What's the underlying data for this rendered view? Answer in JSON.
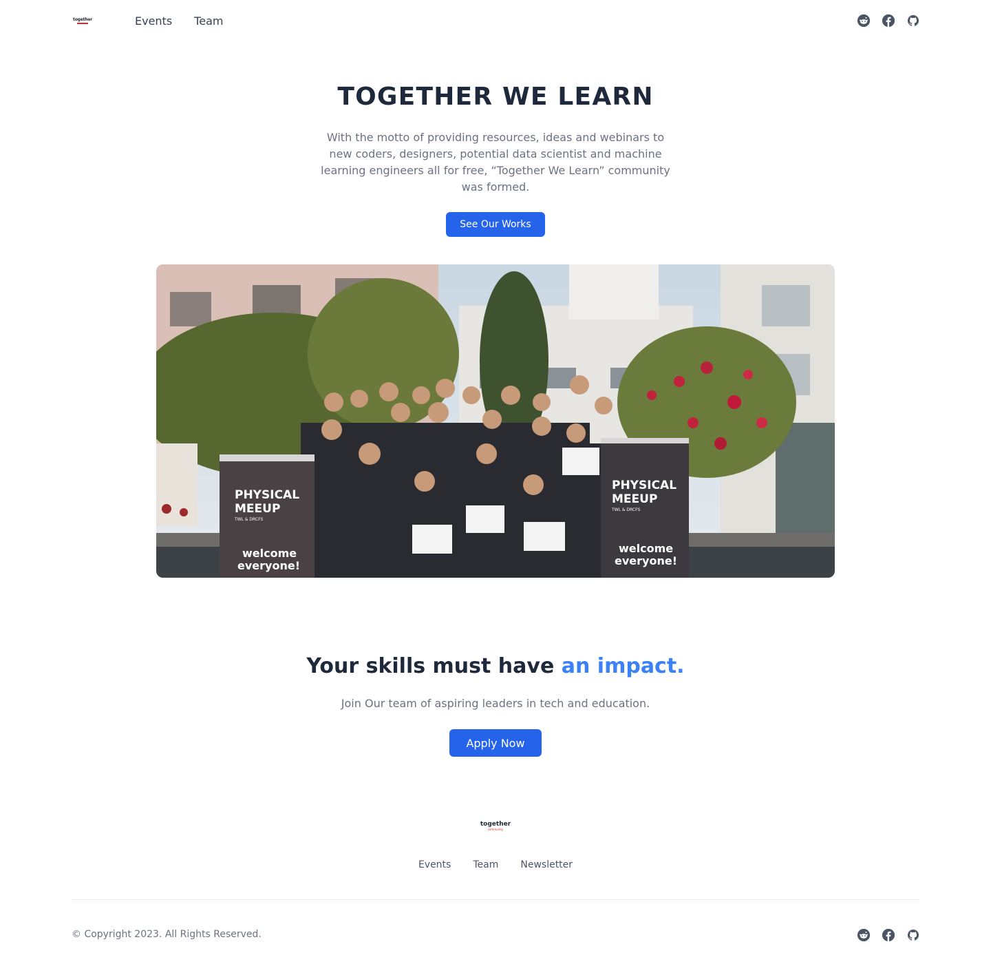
{
  "nav": {
    "logo_text": "together",
    "links": [
      "Events",
      "Team"
    ],
    "social_icons": [
      "reddit-icon",
      "facebook-icon",
      "github-icon"
    ]
  },
  "hero": {
    "title": "TOGETHER WE LEARN",
    "description": "With the motto of providing resources, ideas and webinars to new coders, designers, potential data scientist and machine learning engineers all for free, “Together We Learn” community was formed.",
    "button_label": "See Our Works",
    "photo_banner_text": [
      "PHYSICAL",
      "MEEUP",
      "TWL & DRCFS",
      "welcome",
      "everyone!"
    ]
  },
  "impact": {
    "title_main": "Your skills must have ",
    "title_accent": "an impact.",
    "subtitle": "Join Our team of aspiring leaders in tech and education.",
    "button_label": "Apply Now"
  },
  "footer": {
    "logo_text": "together",
    "logo_sub": "community",
    "links": [
      "Events",
      "Team",
      "Newsletter"
    ],
    "copyright": "© Copyright 2023. All Rights Reserved.",
    "social_icons": [
      "reddit-icon",
      "facebook-icon",
      "github-icon"
    ]
  },
  "colors": {
    "primary": "#2563eb",
    "accent_text": "#3b82f6",
    "heading": "#1e293b",
    "muted": "#6b7280"
  }
}
